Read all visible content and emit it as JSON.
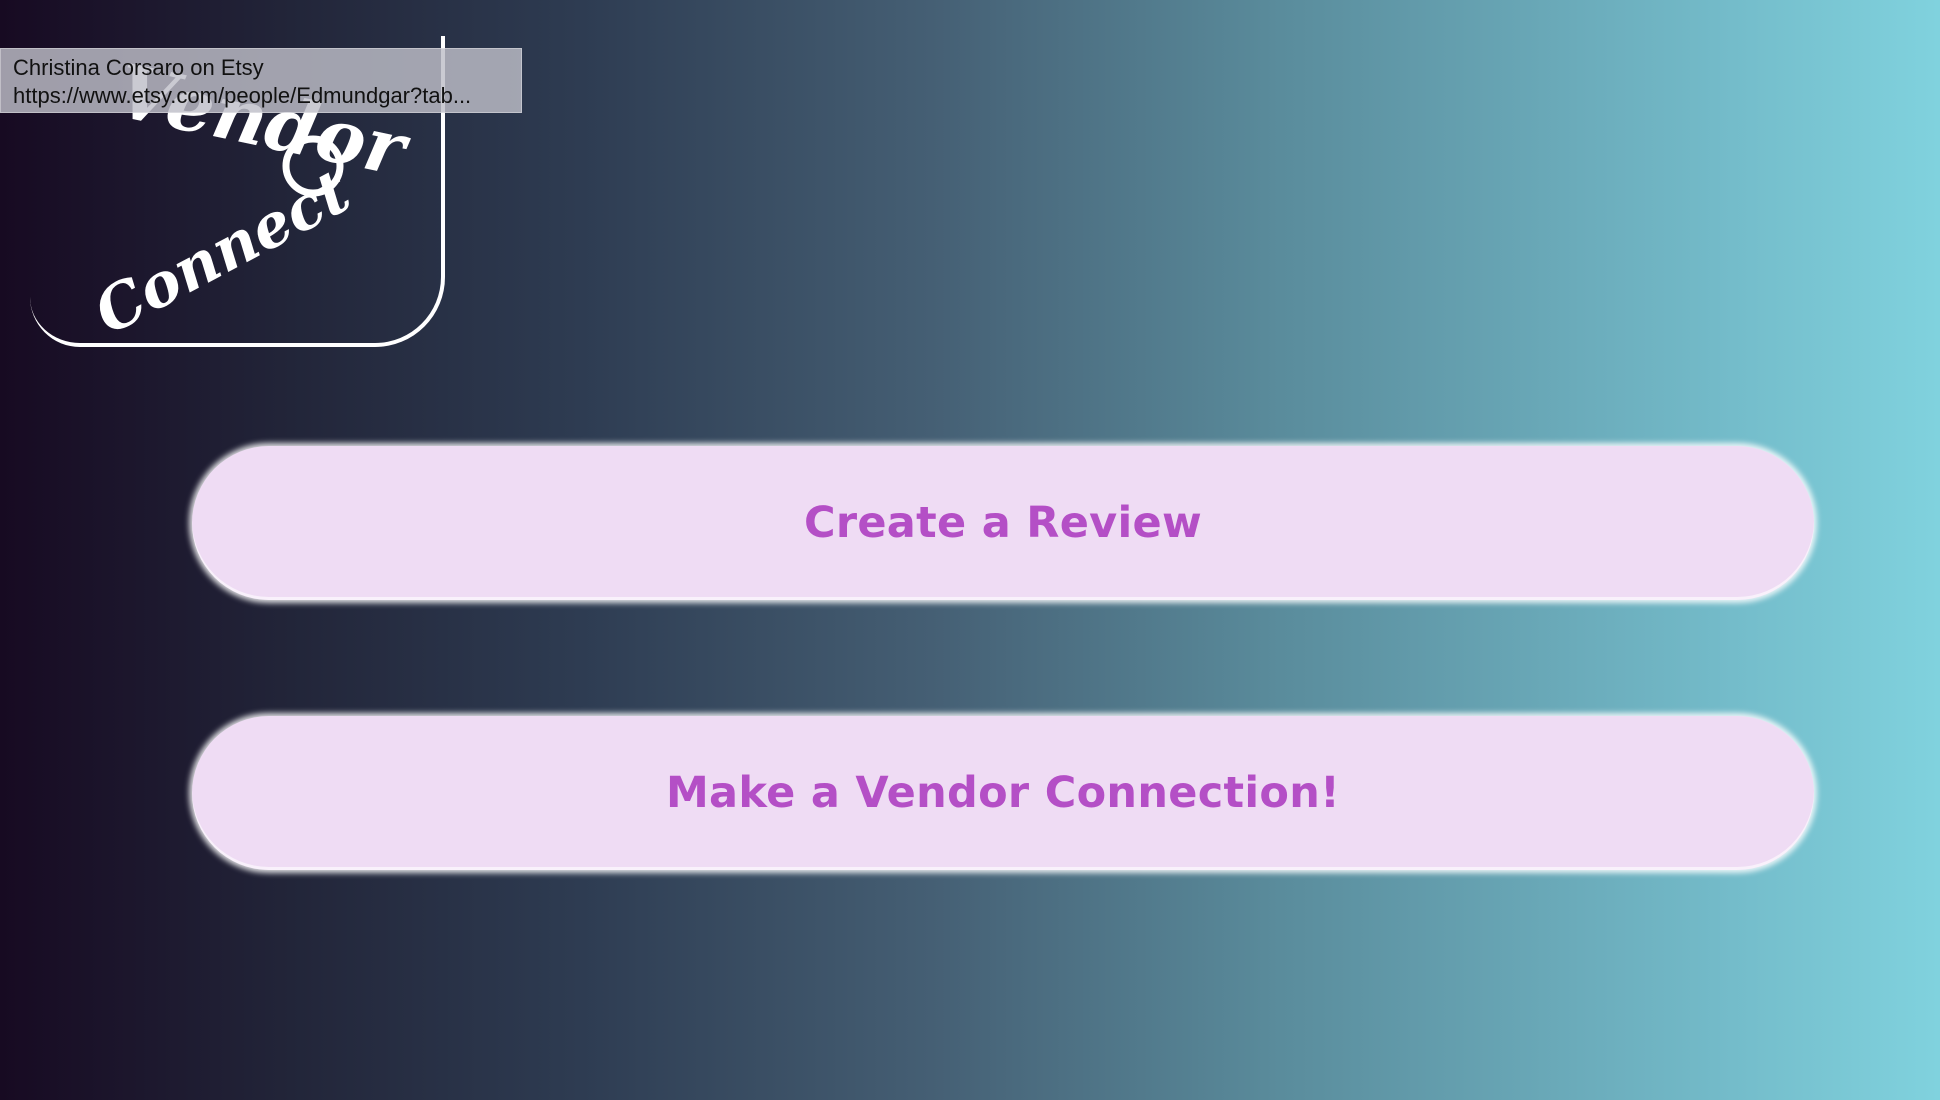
{
  "logo": {
    "line1": "Vendor",
    "line2": "Connect"
  },
  "tooltip": {
    "title": "Christina Corsaro on Etsy",
    "url": "https://www.etsy.com/people/Edmundgar?tab..."
  },
  "actions": {
    "create_review_label": "Create a Review",
    "vendor_connection_label": "Make a Vendor Connection!"
  },
  "colors": {
    "button_bg": "#efdcf4",
    "button_text": "#b44fc6",
    "gradient_start": "#170a22",
    "gradient_end": "#80d2de"
  }
}
